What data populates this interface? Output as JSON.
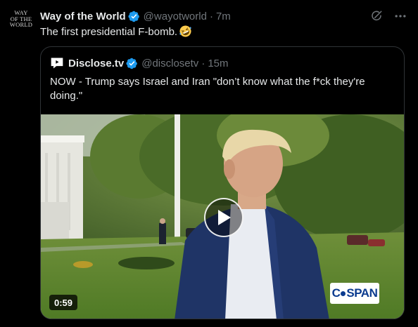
{
  "avatar": {
    "lines": [
      "WAY",
      "OF THE",
      "WORLD"
    ]
  },
  "author": {
    "name": "Way of the World",
    "handle": "@wayotworld",
    "time": "7m",
    "verified_icon": "verified-badge-icon"
  },
  "post": {
    "text": "The first presidential F-bomb.",
    "emoji": "rolling-on-floor-laughing-emoji"
  },
  "actions": {
    "grok_icon": "grok-icon",
    "more_icon": "more-dots-icon"
  },
  "quote": {
    "name": "Disclose.tv",
    "handle": "@disclosetv",
    "time": "15m",
    "text": "NOW - Trump says Israel and Iran \"don’t know what the f*ck they're doing.\"",
    "video": {
      "duration": "0:59",
      "watermark": "SPAN",
      "watermark_prefix": "C"
    }
  },
  "colors": {
    "background": "#000000",
    "text": "#e7e9ea",
    "muted": "#71767b",
    "verified": "#1d9bf0",
    "border": "#2f3336"
  }
}
